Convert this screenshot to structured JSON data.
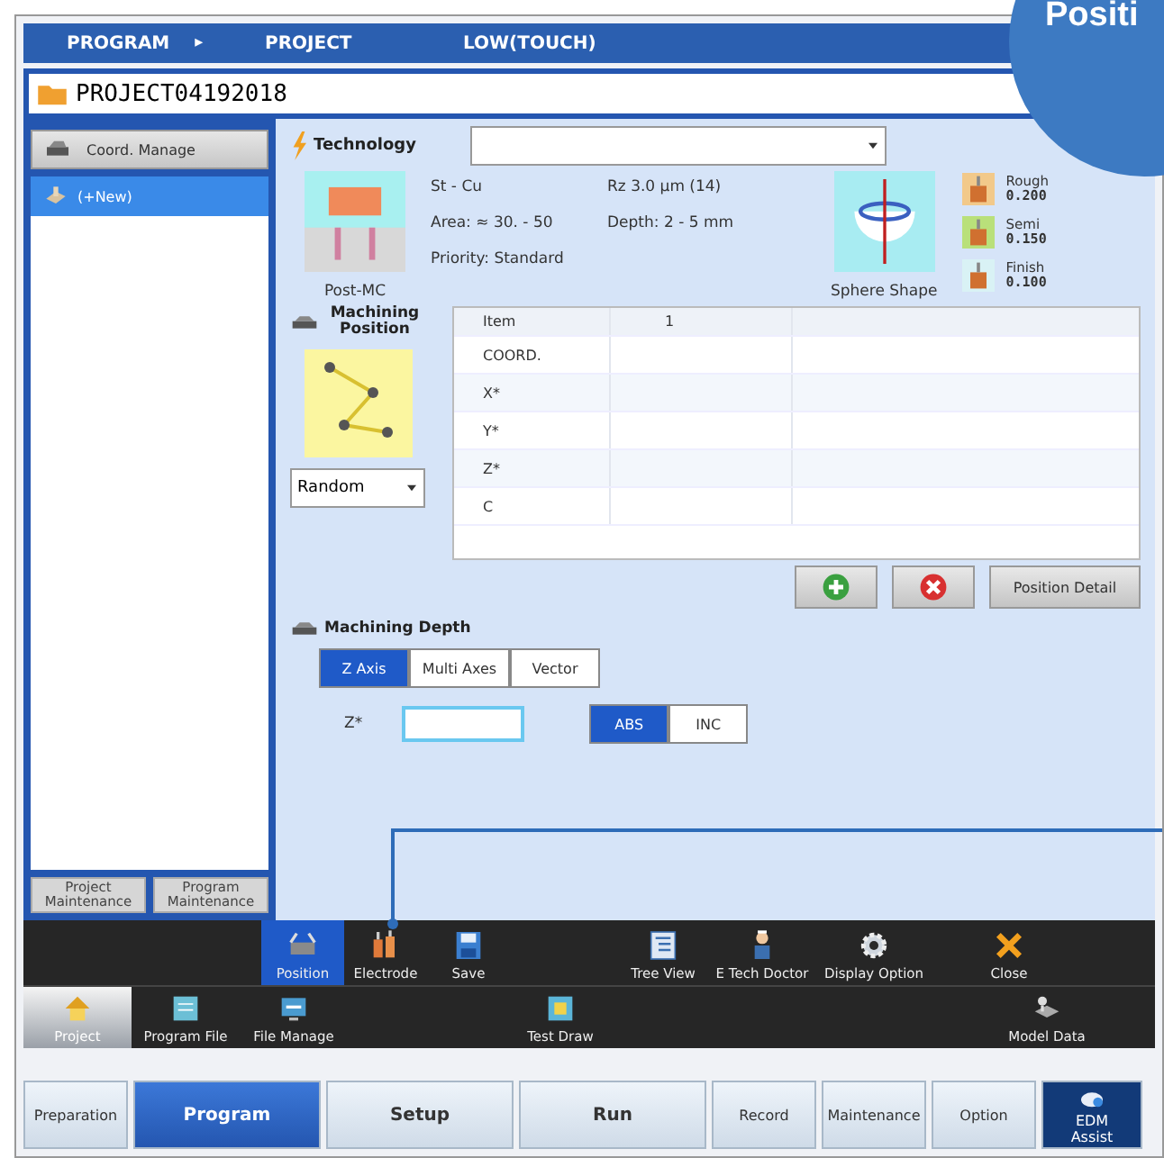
{
  "breadcrumb": [
    {
      "label": "PROGRAM",
      "arrow": "▸"
    },
    {
      "label": "PROJECT"
    },
    {
      "label": "LOW(TOUCH)"
    }
  ],
  "project_name": "PROJECT04192018",
  "sidebar": {
    "coord_button": "Coord. Manage",
    "items": [
      {
        "label": "(+New)",
        "selected": true
      }
    ],
    "buttons": [
      "Project Maintenance",
      "Program Maintenance"
    ]
  },
  "technology": {
    "title": "Technology",
    "electrode_label": "Post-MC",
    "specs": [
      "St - Cu",
      "Rz 3.0 µm (14)",
      "Area: ≈ 30. -  50",
      "Depth:  2 -  5 mm",
      "Priority: Standard"
    ],
    "shape_label": "Sphere Shape",
    "finishes": [
      {
        "name": "Rough",
        "value": "0.200",
        "color": "#f2c98a"
      },
      {
        "name": "Semi",
        "value": "0.150",
        "color": "#b9e07a"
      },
      {
        "name": "Finish",
        "value": "0.100",
        "color": "#d9f2f5"
      }
    ]
  },
  "machining_position": {
    "title": "Machining Position",
    "pattern": "Random",
    "columns": [
      "Item",
      "1"
    ],
    "rows": [
      "COORD.",
      "X*",
      "Y*",
      "Z*",
      "C"
    ],
    "detail_button": "Position Detail"
  },
  "machining_depth": {
    "title": "Machining Depth",
    "axis_tabs": [
      {
        "label": "Z Axis",
        "selected": true
      },
      {
        "label": "Multi Axes",
        "selected": false
      },
      {
        "label": "Vector",
        "selected": false
      }
    ],
    "z_label": "Z*",
    "mode_tabs": [
      {
        "label": "ABS",
        "selected": true
      },
      {
        "label": "INC",
        "selected": false
      }
    ]
  },
  "toolbar": [
    {
      "label": "Position",
      "selected": true
    },
    {
      "label": "Electrode",
      "selected": false
    },
    {
      "label": "Save",
      "selected": false
    },
    {
      "label": "Tree View",
      "selected": false
    },
    {
      "label": "E Tech Doctor",
      "selected": false
    },
    {
      "label": "Display Option",
      "selected": false
    },
    {
      "label": "Close",
      "selected": false
    }
  ],
  "toolbar2": [
    {
      "label": "Project",
      "selected": true
    },
    {
      "label": "Program File",
      "selected": false
    },
    {
      "label": "File Manage",
      "selected": false
    },
    {
      "label": "Test Draw",
      "selected": false
    },
    {
      "label": "Model Data",
      "selected": false
    }
  ],
  "nav": [
    {
      "label": "Preparation",
      "selected": false,
      "kind": "small"
    },
    {
      "label": "Program",
      "selected": true,
      "kind": "large"
    },
    {
      "label": "Setup",
      "selected": false,
      "kind": "large"
    },
    {
      "label": "Run",
      "selected": false,
      "kind": "large"
    },
    {
      "label": "Record",
      "selected": false,
      "kind": "small"
    },
    {
      "label": "Maintenance",
      "selected": false,
      "kind": "small"
    },
    {
      "label": "Option",
      "selected": false,
      "kind": "small"
    },
    {
      "label": "EDM Assist",
      "selected": false,
      "kind": "assist"
    }
  ],
  "callout": {
    "text": "Positi"
  }
}
